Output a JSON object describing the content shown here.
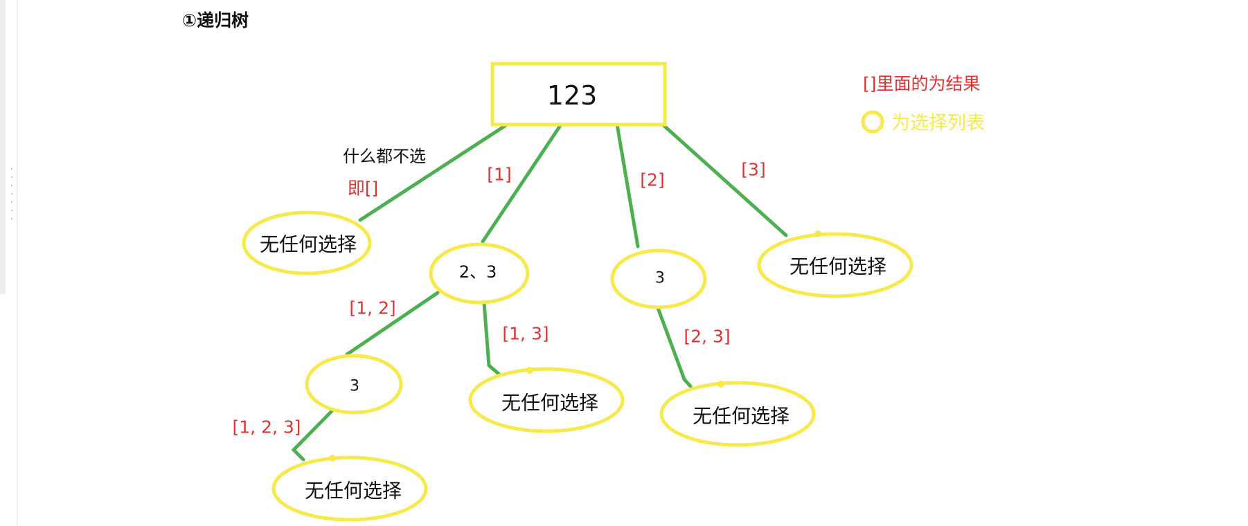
{
  "title": "①递归树",
  "colors": {
    "node_outline": "#f7e94a",
    "edge": "#4caf50",
    "result_label": "#e03131",
    "note_text": "#111111"
  },
  "legend": {
    "result_text": "[]里面的为结果",
    "choice_text": "为选择列表"
  },
  "root": {
    "label": "123"
  },
  "nodes": {
    "empty_root": "无任何选择",
    "n23": "2、3",
    "n3_mid": "3",
    "empty_3": "无任何选择",
    "n3_low": "3",
    "empty_13": "无任何选择",
    "empty_23": "无任何选择",
    "empty_123": "无任何选择"
  },
  "edge_labels": {
    "root_empty_note": "什么都不选",
    "root_empty": "即[]",
    "root_n23": "[1]",
    "root_n3": "[2]",
    "root_empty3": "[3]",
    "n23_n3": "[1, 2]",
    "n23_empty": "[1, 3]",
    "n3_empty": "[2, 3]",
    "n3low_empty": "[1, 2, 3]"
  }
}
